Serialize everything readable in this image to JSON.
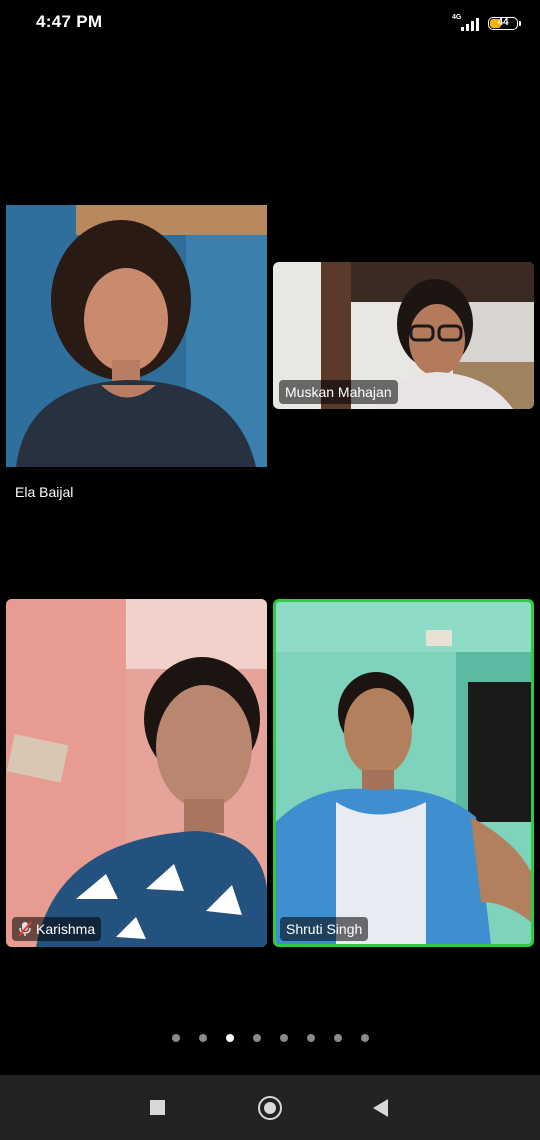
{
  "status_bar": {
    "time": "4:47 PM",
    "network": "4G",
    "battery_level": "44",
    "battery_color": "#f4b400"
  },
  "participants": [
    {
      "name": "Ela Baijal",
      "muted": false,
      "active_speaker": false
    },
    {
      "name": "Muskan Mahajan",
      "muted": false,
      "active_speaker": false
    },
    {
      "name": "Karishma",
      "muted": true,
      "active_speaker": false,
      "icon": "mic-muted-icon"
    },
    {
      "name": "Shruti Singh",
      "muted": false,
      "active_speaker": true
    }
  ],
  "colors": {
    "active_speaker_border": "#2ecc40",
    "muted_mic": "#e53935"
  },
  "pagination": {
    "total_pages": 8,
    "current_page": 3
  },
  "nav_bar": {
    "icons": [
      "recent-apps-icon",
      "home-icon",
      "back-icon"
    ]
  }
}
